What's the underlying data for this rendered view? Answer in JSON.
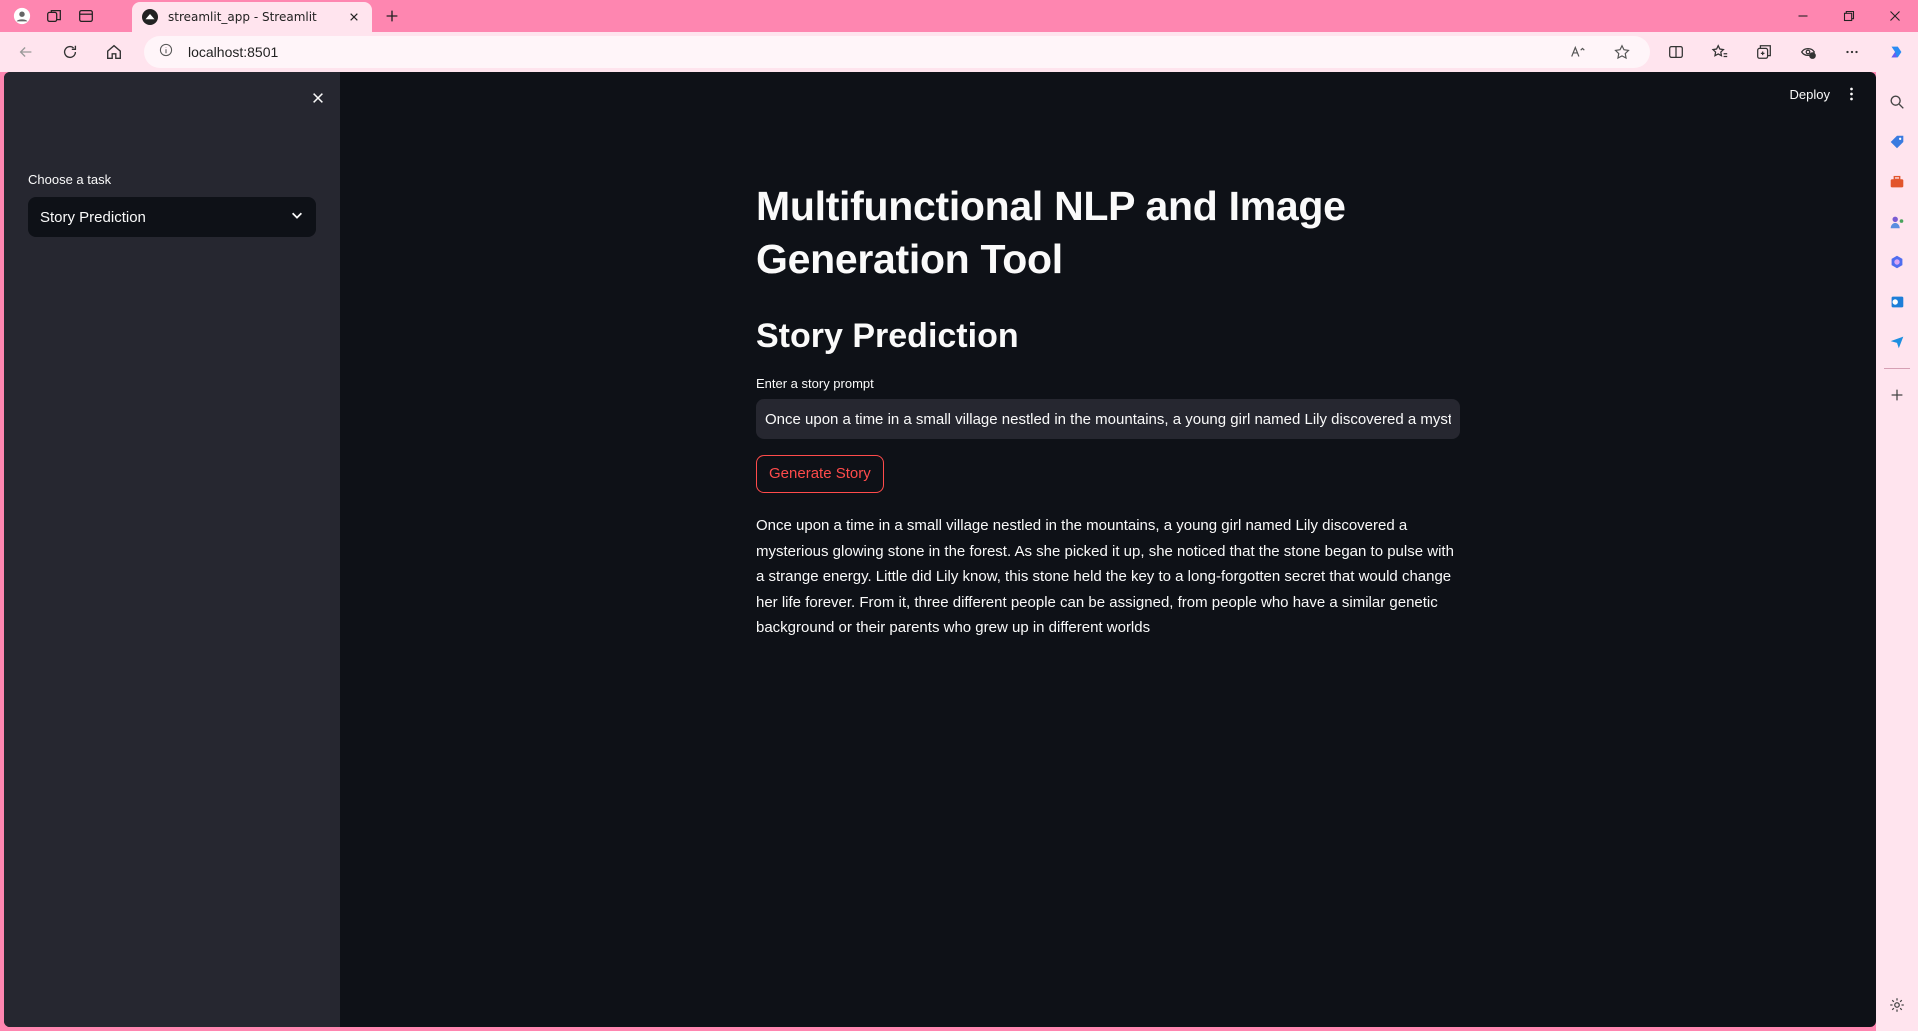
{
  "browser": {
    "tab_title": "streamlit_app - Streamlit",
    "url": "localhost:8501"
  },
  "app": {
    "deploy_label": "Deploy",
    "sidebar": {
      "select_label": "Choose a task",
      "select_value": "Story Prediction"
    },
    "main": {
      "title": "Multifunctional NLP and Image Generation Tool",
      "subheader": "Story Prediction",
      "input_label": "Enter a story prompt",
      "input_value": "Once upon a time in a small village nestled in the mountains, a young girl named Lily discovered a mysterious glowing stone in the forest.",
      "button_label": "Generate Story",
      "story_text": "Once upon a time in a small village nestled in the mountains, a young girl named Lily discovered a mysterious glowing stone in the forest. As she picked it up, she noticed that the stone began to pulse with a strange energy. Little did Lily know, this stone held the key to a long-forgotten secret that would change her life forever.  From it, three different people can be assigned, from people who have a similar genetic background or their parents who grew up in different worlds"
    }
  },
  "colors": {
    "chrome_pink": "#fe86b0",
    "toolbar_pink": "#ffe4ee",
    "app_bg": "#0e1117",
    "sidebar_bg": "#262730",
    "accent_red": "#ff4b4b"
  }
}
